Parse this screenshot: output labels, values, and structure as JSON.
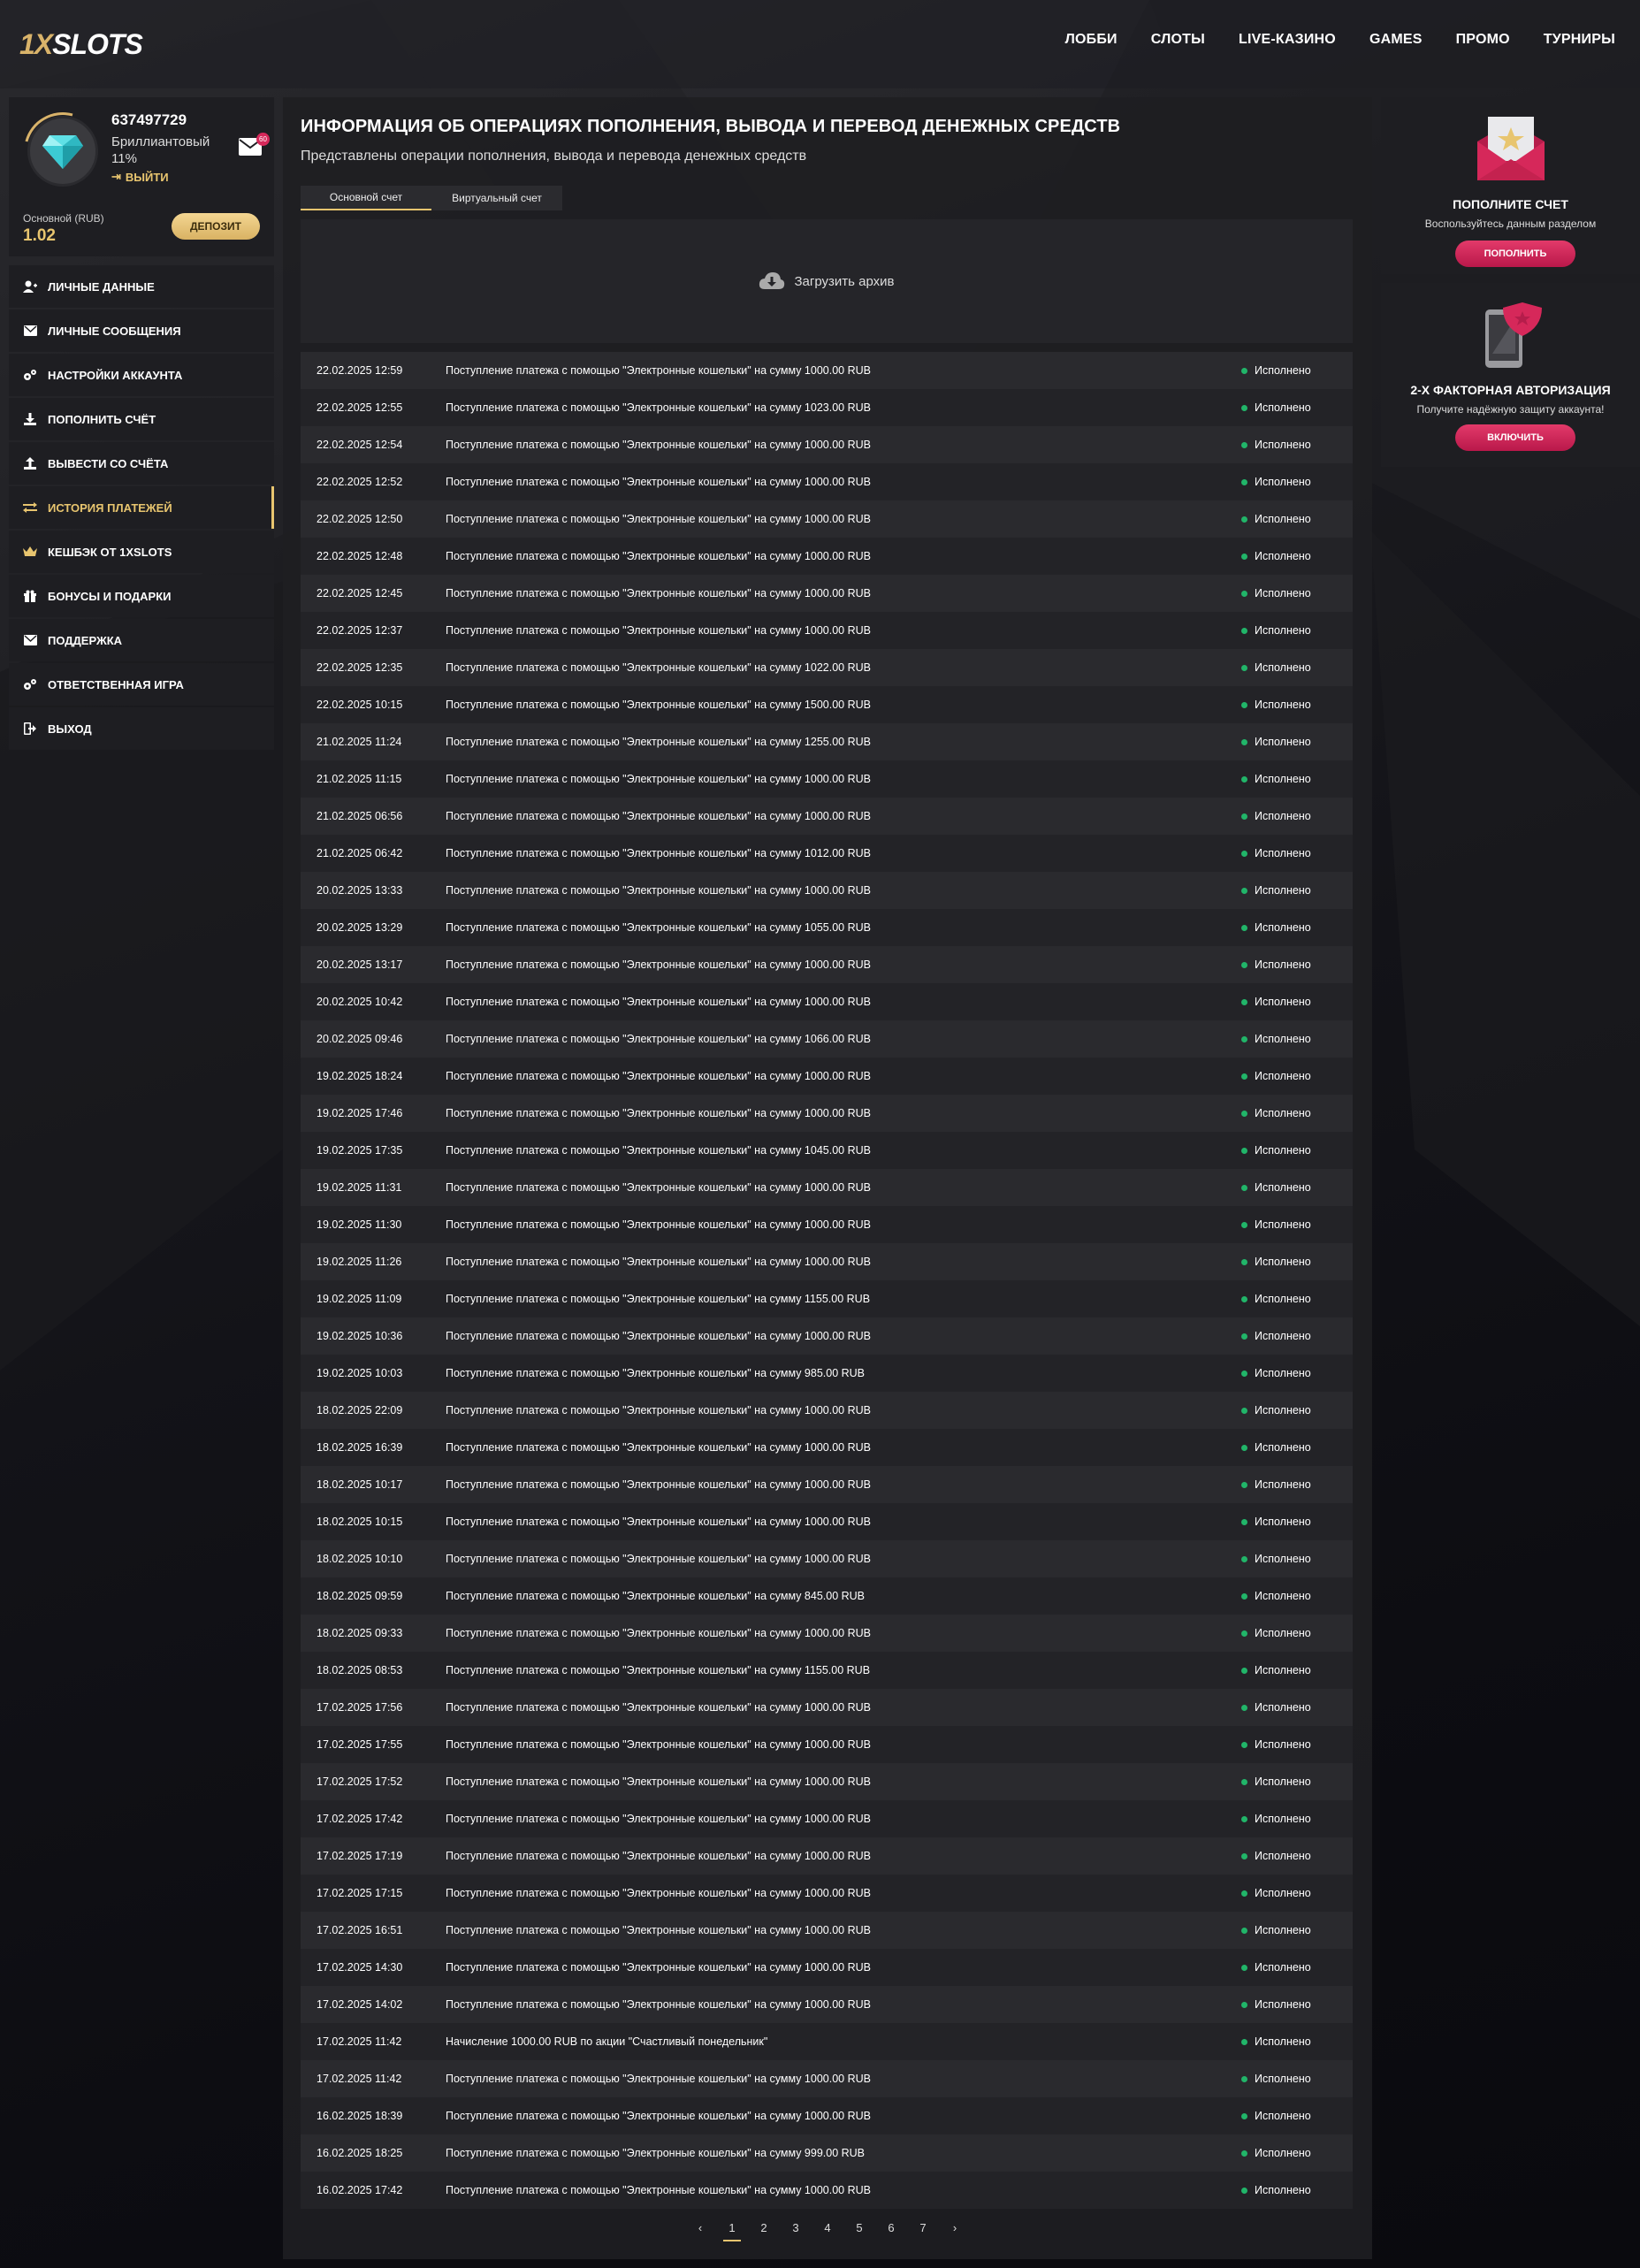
{
  "header": {
    "logo_part1": "1X",
    "logo_part2": "SLOTS",
    "nav": [
      "ЛОББИ",
      "СЛОТЫ",
      "LIVE-КАЗИНО",
      "GAMES",
      "ПРОМО",
      "ТУРНИРЫ"
    ]
  },
  "profile": {
    "user_id": "637497729",
    "rank": "Бриллиантовый",
    "progress": "11%",
    "logout_label": "ВЫЙТИ",
    "mail_count": "60",
    "balance_label": "Основной (RUB)",
    "balance_value": "1.02",
    "deposit_label": "ДЕПОЗИТ"
  },
  "menu": [
    {
      "label": "ЛИЧНЫЕ ДАННЫЕ",
      "icon": "user-add-icon"
    },
    {
      "label": "ЛИЧНЫЕ СООБЩЕНИЯ",
      "icon": "envelope-icon"
    },
    {
      "label": "НАСТРОЙКИ АККАУНТА",
      "icon": "gears-icon"
    },
    {
      "label": "ПОПОЛНИТЬ СЧЁТ",
      "icon": "download-icon"
    },
    {
      "label": "ВЫВЕСТИ СО СЧЁТА",
      "icon": "upload-icon"
    },
    {
      "label": "ИСТОРИЯ ПЛАТЕЖЕЙ",
      "icon": "exchange-icon",
      "active": true
    },
    {
      "label": "КЕШБЭК ОТ 1XSLOTS",
      "icon": "crown-icon"
    },
    {
      "label": "БОНУСЫ И ПОДАРКИ",
      "icon": "gift-icon"
    },
    {
      "label": "ПОДДЕРЖКА",
      "icon": "envelope-icon"
    },
    {
      "label": "ОТВЕТСТВЕННАЯ ИГРА",
      "icon": "gears-icon"
    },
    {
      "label": "ВЫХОД",
      "icon": "logout-icon"
    }
  ],
  "main": {
    "title": "ИНФОРМАЦИЯ ОБ ОПЕРАЦИЯХ ПОПОЛНЕНИЯ, ВЫВОДА И ПЕРЕВОД ДЕНЕЖНЫХ СРЕДСТВ",
    "subtitle": "Представлены операции пополнения, вывода и перевода денежных средств",
    "tabs": [
      "Основной счет",
      "Виртуальный счет"
    ],
    "archive_label": "Загрузить архив",
    "status_color": "#21b569"
  },
  "transactions": [
    {
      "date": "22.02.2025 12:59",
      "desc": "Поступление платежа с помощью \"Электронные кошельки\" на сумму 1000.00 RUB",
      "status": "Исполнено"
    },
    {
      "date": "22.02.2025 12:55",
      "desc": "Поступление платежа с помощью \"Электронные кошельки\" на сумму 1023.00 RUB",
      "status": "Исполнено"
    },
    {
      "date": "22.02.2025 12:54",
      "desc": "Поступление платежа с помощью \"Электронные кошельки\" на сумму 1000.00 RUB",
      "status": "Исполнено"
    },
    {
      "date": "22.02.2025 12:52",
      "desc": "Поступление платежа с помощью \"Электронные кошельки\" на сумму 1000.00 RUB",
      "status": "Исполнено"
    },
    {
      "date": "22.02.2025 12:50",
      "desc": "Поступление платежа с помощью \"Электронные кошельки\" на сумму 1000.00 RUB",
      "status": "Исполнено"
    },
    {
      "date": "22.02.2025 12:48",
      "desc": "Поступление платежа с помощью \"Электронные кошельки\" на сумму 1000.00 RUB",
      "status": "Исполнено"
    },
    {
      "date": "22.02.2025 12:45",
      "desc": "Поступление платежа с помощью \"Электронные кошельки\" на сумму 1000.00 RUB",
      "status": "Исполнено"
    },
    {
      "date": "22.02.2025 12:37",
      "desc": "Поступление платежа с помощью \"Электронные кошельки\" на сумму 1000.00 RUB",
      "status": "Исполнено"
    },
    {
      "date": "22.02.2025 12:35",
      "desc": "Поступление платежа с помощью \"Электронные кошельки\" на сумму 1022.00 RUB",
      "status": "Исполнено"
    },
    {
      "date": "22.02.2025 10:15",
      "desc": "Поступление платежа с помощью \"Электронные кошельки\" на сумму 1500.00 RUB",
      "status": "Исполнено"
    },
    {
      "date": "21.02.2025 11:24",
      "desc": "Поступление платежа с помощью \"Электронные кошельки\" на сумму 1255.00 RUB",
      "status": "Исполнено"
    },
    {
      "date": "21.02.2025 11:15",
      "desc": "Поступление платежа с помощью \"Электронные кошельки\" на сумму 1000.00 RUB",
      "status": "Исполнено"
    },
    {
      "date": "21.02.2025 06:56",
      "desc": "Поступление платежа с помощью \"Электронные кошельки\" на сумму 1000.00 RUB",
      "status": "Исполнено"
    },
    {
      "date": "21.02.2025 06:42",
      "desc": "Поступление платежа с помощью \"Электронные кошельки\" на сумму 1012.00 RUB",
      "status": "Исполнено"
    },
    {
      "date": "20.02.2025 13:33",
      "desc": "Поступление платежа с помощью \"Электронные кошельки\" на сумму 1000.00 RUB",
      "status": "Исполнено"
    },
    {
      "date": "20.02.2025 13:29",
      "desc": "Поступление платежа с помощью \"Электронные кошельки\" на сумму 1055.00 RUB",
      "status": "Исполнено"
    },
    {
      "date": "20.02.2025 13:17",
      "desc": "Поступление платежа с помощью \"Электронные кошельки\" на сумму 1000.00 RUB",
      "status": "Исполнено"
    },
    {
      "date": "20.02.2025 10:42",
      "desc": "Поступление платежа с помощью \"Электронные кошельки\" на сумму 1000.00 RUB",
      "status": "Исполнено"
    },
    {
      "date": "20.02.2025 09:46",
      "desc": "Поступление платежа с помощью \"Электронные кошельки\" на сумму 1066.00 RUB",
      "status": "Исполнено"
    },
    {
      "date": "19.02.2025 18:24",
      "desc": "Поступление платежа с помощью \"Электронные кошельки\" на сумму 1000.00 RUB",
      "status": "Исполнено"
    },
    {
      "date": "19.02.2025 17:46",
      "desc": "Поступление платежа с помощью \"Электронные кошельки\" на сумму 1000.00 RUB",
      "status": "Исполнено"
    },
    {
      "date": "19.02.2025 17:35",
      "desc": "Поступление платежа с помощью \"Электронные кошельки\" на сумму 1045.00 RUB",
      "status": "Исполнено"
    },
    {
      "date": "19.02.2025 11:31",
      "desc": "Поступление платежа с помощью \"Электронные кошельки\" на сумму 1000.00 RUB",
      "status": "Исполнено"
    },
    {
      "date": "19.02.2025 11:30",
      "desc": "Поступление платежа с помощью \"Электронные кошельки\" на сумму 1000.00 RUB",
      "status": "Исполнено"
    },
    {
      "date": "19.02.2025 11:26",
      "desc": "Поступление платежа с помощью \"Электронные кошельки\" на сумму 1000.00 RUB",
      "status": "Исполнено"
    },
    {
      "date": "19.02.2025 11:09",
      "desc": "Поступление платежа с помощью \"Электронные кошельки\" на сумму 1155.00 RUB",
      "status": "Исполнено"
    },
    {
      "date": "19.02.2025 10:36",
      "desc": "Поступление платежа с помощью \"Электронные кошельки\" на сумму 1000.00 RUB",
      "status": "Исполнено"
    },
    {
      "date": "19.02.2025 10:03",
      "desc": "Поступление платежа с помощью \"Электронные кошельки\" на сумму 985.00 RUB",
      "status": "Исполнено"
    },
    {
      "date": "18.02.2025 22:09",
      "desc": "Поступление платежа с помощью \"Электронные кошельки\" на сумму 1000.00 RUB",
      "status": "Исполнено"
    },
    {
      "date": "18.02.2025 16:39",
      "desc": "Поступление платежа с помощью \"Электронные кошельки\" на сумму 1000.00 RUB",
      "status": "Исполнено"
    },
    {
      "date": "18.02.2025 10:17",
      "desc": "Поступление платежа с помощью \"Электронные кошельки\" на сумму 1000.00 RUB",
      "status": "Исполнено"
    },
    {
      "date": "18.02.2025 10:15",
      "desc": "Поступление платежа с помощью \"Электронные кошельки\" на сумму 1000.00 RUB",
      "status": "Исполнено"
    },
    {
      "date": "18.02.2025 10:10",
      "desc": "Поступление платежа с помощью \"Электронные кошельки\" на сумму 1000.00 RUB",
      "status": "Исполнено"
    },
    {
      "date": "18.02.2025 09:59",
      "desc": "Поступление платежа с помощью \"Электронные кошельки\" на сумму 845.00 RUB",
      "status": "Исполнено"
    },
    {
      "date": "18.02.2025 09:33",
      "desc": "Поступление платежа с помощью \"Электронные кошельки\" на сумму 1000.00 RUB",
      "status": "Исполнено"
    },
    {
      "date": "18.02.2025 08:53",
      "desc": "Поступление платежа с помощью \"Электронные кошельки\" на сумму 1155.00 RUB",
      "status": "Исполнено"
    },
    {
      "date": "17.02.2025 17:56",
      "desc": "Поступление платежа с помощью \"Электронные кошельки\" на сумму 1000.00 RUB",
      "status": "Исполнено"
    },
    {
      "date": "17.02.2025 17:55",
      "desc": "Поступление платежа с помощью \"Электронные кошельки\" на сумму 1000.00 RUB",
      "status": "Исполнено"
    },
    {
      "date": "17.02.2025 17:52",
      "desc": "Поступление платежа с помощью \"Электронные кошельки\" на сумму 1000.00 RUB",
      "status": "Исполнено"
    },
    {
      "date": "17.02.2025 17:42",
      "desc": "Поступление платежа с помощью \"Электронные кошельки\" на сумму 1000.00 RUB",
      "status": "Исполнено"
    },
    {
      "date": "17.02.2025 17:19",
      "desc": "Поступление платежа с помощью \"Электронные кошельки\" на сумму 1000.00 RUB",
      "status": "Исполнено"
    },
    {
      "date": "17.02.2025 17:15",
      "desc": "Поступление платежа с помощью \"Электронные кошельки\" на сумму 1000.00 RUB",
      "status": "Исполнено"
    },
    {
      "date": "17.02.2025 16:51",
      "desc": "Поступление платежа с помощью \"Электронные кошельки\" на сумму 1000.00 RUB",
      "status": "Исполнено"
    },
    {
      "date": "17.02.2025 14:30",
      "desc": "Поступление платежа с помощью \"Электронные кошельки\" на сумму 1000.00 RUB",
      "status": "Исполнено"
    },
    {
      "date": "17.02.2025 14:02",
      "desc": "Поступление платежа с помощью \"Электронные кошельки\" на сумму 1000.00 RUB",
      "status": "Исполнено"
    },
    {
      "date": "17.02.2025 11:42",
      "desc": "Начисление 1000.00 RUB по акции \"Счастливый понедельник\"",
      "status": "Исполнено"
    },
    {
      "date": "17.02.2025 11:42",
      "desc": "Поступление платежа с помощью \"Электронные кошельки\" на сумму 1000.00 RUB",
      "status": "Исполнено"
    },
    {
      "date": "16.02.2025 18:39",
      "desc": "Поступление платежа с помощью \"Электронные кошельки\" на сумму 1000.00 RUB",
      "status": "Исполнено"
    },
    {
      "date": "16.02.2025 18:25",
      "desc": "Поступление платежа с помощью \"Электронные кошельки\" на сумму 999.00 RUB",
      "status": "Исполнено"
    },
    {
      "date": "16.02.2025 17:42",
      "desc": "Поступление платежа с помощью \"Электронные кошельки\" на сумму 1000.00 RUB",
      "status": "Исполнено"
    }
  ],
  "pagination": {
    "prev": "‹",
    "next": "›",
    "pages": [
      "1",
      "2",
      "3",
      "4",
      "5",
      "6",
      "7"
    ],
    "current": "1"
  },
  "cards": {
    "deposit": {
      "title": "ПОПОЛНИТЕ СЧЕТ",
      "text": "Воспользуйтесь данным разделом",
      "button": "ПОПОЛНИТЬ"
    },
    "twofa": {
      "title": "2-Х ФАКТОРНАЯ АВТОРИЗАЦИЯ",
      "text": "Получите надёжную защиту аккаунта!",
      "button": "ВКЛЮЧИТЬ"
    }
  },
  "colors": {
    "accent": "#e8c56f",
    "button_pink": "#d6285a",
    "success": "#21b569"
  }
}
